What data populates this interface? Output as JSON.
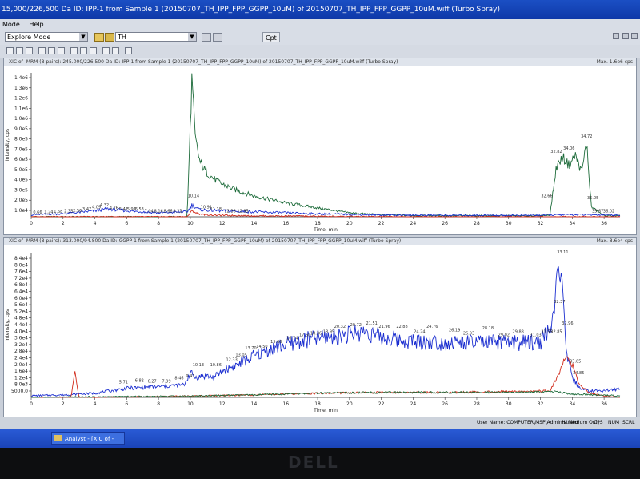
{
  "window": {
    "title": "15,000/226,500 Da ID: IPP-1 from Sample 1 (20150707_TH_IPP_FPP_GGPP_10uM) of 20150707_TH_IPP_FPP_GGPP_10uM.wiff (Turbo Spray)"
  },
  "menu": {
    "items": [
      "Mode",
      "Help"
    ]
  },
  "toolbar": {
    "mode_value": "Explore Mode",
    "history_value": "TH",
    "button_label": "Cpt"
  },
  "pane1": {
    "header": "XIC of -MRM (8 pairs): 245.000/226.500 Da ID: IPP-1 from Sample 1 (20150707_TH_IPP_FPP_GGPP_10uM) of 20150707_TH_IPP_FPP_GGPP_10uM.wiff (Turbo Spray)",
    "max_label": "Max. 1.6e6 cps",
    "xlabel": "Time, min",
    "ylabel": "Intensity, cps"
  },
  "pane2": {
    "header": "XIC of -MRM (8 pairs): 313.000/94.800 Da ID: GGPP-1 from Sample 1 (20150707_TH_IPP_FPP_GGPP_10uM) of 20150707_TH_IPP_FPP_GGPP_10uM.wiff (Turbo Spray)",
    "max_label": "Max. 8.6e4 cps",
    "xlabel": "Time, min",
    "ylabel": "Intensity, cps"
  },
  "status": {
    "user": "User Name: COMPUTER\\MSP\\Administrator",
    "mode": "HI Medium Only",
    "cps": "CPS",
    "num": "NUM",
    "scroll": "SCRL"
  },
  "taskbar": {
    "app_label": "Analyst - [XIC of -MR..."
  },
  "monitor": {
    "brand": "DELL"
  },
  "colors": {
    "blue_trace": "#1c2fd0",
    "green_trace": "#1d6b3a",
    "red_trace": "#d12a1a",
    "titlebar": "#1b4fc4"
  },
  "chart_data": [
    {
      "type": "line",
      "xlim": [
        0,
        37
      ],
      "ylim": [
        0,
        1450000.0
      ],
      "x_ticks": [
        "0",
        "2",
        "4",
        "6",
        "8",
        "10",
        "12",
        "14",
        "16",
        "18",
        "20",
        "22",
        "24",
        "26",
        "28",
        "30",
        "32",
        "34",
        "36"
      ],
      "y_ticks": [
        "1.0e4",
        "2.0e5",
        "3.0e5",
        "4.0e5",
        "5.0e5",
        "6.0e5",
        "7.0e5",
        "8.0e5",
        "9.0e5",
        "1.0e6",
        "1.1e6",
        "1.2e6",
        "1.3e6",
        "1.4e6"
      ],
      "series": [
        {
          "color": "green",
          "x": [
            0,
            9.8,
            10.1,
            10.3,
            10.6,
            11,
            11.5,
            12,
            13,
            14,
            16,
            18,
            20,
            22,
            24,
            32,
            32.6,
            33,
            33.4,
            33.8,
            34.2,
            34.6,
            34.9,
            35.2,
            36
          ],
          "y": [
            0,
            0,
            1400000.0,
            800000.0,
            550000.0,
            450000.0,
            380000.0,
            330000.0,
            260000.0,
            210000.0,
            140000.0,
            90000.0,
            40000.0,
            20000.0,
            12000.0,
            10000.0,
            20000.0,
            500000.0,
            600000.0,
            520000.0,
            620000.0,
            450000.0,
            750000.0,
            100000.0,
            10000.0
          ]
        },
        {
          "color": "blue",
          "x": [
            0,
            2,
            4,
            4.8,
            6,
            8,
            9.8,
            10.1,
            10.6,
            12,
            14,
            18,
            22,
            26,
            30,
            32,
            33,
            34,
            35,
            36
          ],
          "y": [
            20000.0,
            30000.0,
            60000.0,
            80000.0,
            60000.0,
            40000.0,
            50000.0,
            120000.0,
            70000.0,
            60000.0,
            50000.0,
            30000.0,
            18000.0,
            15000.0,
            15000.0,
            15000.0,
            20000.0,
            22000.0,
            20000.0,
            20000.0
          ]
        },
        {
          "color": "red",
          "x": [
            0,
            9.8,
            10.1,
            10.5,
            11,
            12,
            14,
            16,
            18,
            20,
            22,
            24,
            36
          ],
          "y": [
            0,
            0,
            60000.0,
            30000.0,
            20000.0,
            15000.0,
            10000.0,
            8000.0,
            5000.0,
            3000.0,
            1000.0,
            0,
            0
          ]
        }
      ],
      "peak_labels": [
        {
          "t": "0.66",
          "x": 0.4,
          "y": 15000.0
        },
        {
          "t": "1.24",
          "x": 1.1,
          "y": 20000.0
        },
        {
          "t": "1.68",
          "x": 1.7,
          "y": 25000.0
        },
        {
          "t": "2.35",
          "x": 2.35,
          "y": 30000.0
        },
        {
          "t": "2.56",
          "x": 2.9,
          "y": 32000.0
        },
        {
          "t": "3.47",
          "x": 3.5,
          "y": 50000.0
        },
        {
          "t": "4.09",
          "x": 4.1,
          "y": 70000.0
        },
        {
          "t": "4.32",
          "x": 4.6,
          "y": 90000.0
        },
        {
          "t": "4.76",
          "x": 5.2,
          "y": 60000.0
        },
        {
          "t": "5.41",
          "x": 5.8,
          "y": 50000.0
        },
        {
          "t": "5.97",
          "x": 6.3,
          "y": 50000.0
        },
        {
          "t": "6.53",
          "x": 6.8,
          "y": 50000.0
        },
        {
          "t": "7.04",
          "x": 7.4,
          "y": 30000.0
        },
        {
          "t": "8.16",
          "x": 8.0,
          "y": 30000.0
        },
        {
          "t": "8.66",
          "x": 8.6,
          "y": 30000.0
        },
        {
          "t": "9.23",
          "x": 9.2,
          "y": 30000.0
        },
        {
          "t": "10.14",
          "x": 10.2,
          "y": 180000.0
        },
        {
          "t": "10.91",
          "x": 11.0,
          "y": 70000.0
        },
        {
          "t": "11.18",
          "x": 11.6,
          "y": 50000.0
        },
        {
          "t": "12.38",
          "x": 12.5,
          "y": 30000.0
        },
        {
          "t": "12.95",
          "x": 13.3,
          "y": 30000.0
        },
        {
          "t": "32.66",
          "x": 32.4,
          "y": 180000.0
        },
        {
          "t": "32.82",
          "x": 33.0,
          "y": 630000.0
        },
        {
          "t": "34.06",
          "x": 33.8,
          "y": 660000.0
        },
        {
          "t": "34.72",
          "x": 34.9,
          "y": 780000.0
        },
        {
          "t": "35.05",
          "x": 35.3,
          "y": 160000.0
        },
        {
          "t": "35.67",
          "x": 35.6,
          "y": 30000.0
        },
        {
          "t": "36.02",
          "x": 36.3,
          "y": 30000.0
        }
      ]
    },
    {
      "type": "line",
      "xlim": [
        0,
        37
      ],
      "ylim": [
        0,
        87000.0
      ],
      "x_ticks": [
        "0",
        "2",
        "4",
        "6",
        "8",
        "10",
        "12",
        "14",
        "16",
        "18",
        "20",
        "22",
        "24",
        "26",
        "28",
        "30",
        "32",
        "34",
        "36"
      ],
      "y_ticks": [
        "5000.0",
        "8.0e3",
        "1.2e4",
        "1.6e4",
        "2.0e4",
        "2.4e4",
        "2.8e4",
        "3.2e4",
        "3.6e4",
        "4.0e4",
        "4.4e4",
        "4.8e4",
        "5.2e4",
        "5.6e4",
        "6.0e4",
        "6.4e4",
        "6.8e4",
        "7.2e4",
        "7.6e4",
        "8.0e4",
        "8.4e4"
      ],
      "series": [
        {
          "color": "blue",
          "x": [
            0,
            2,
            4,
            6,
            8,
            9.6,
            10,
            10.3,
            11,
            11.5,
            12,
            13,
            14,
            15,
            16,
            17,
            18,
            19,
            20,
            21,
            22,
            23,
            24,
            25,
            26,
            27,
            28,
            29,
            30,
            31,
            32,
            32.8,
            33.2,
            33.6,
            34,
            34.6,
            35,
            36,
            37
          ],
          "y": [
            1000.0,
            1500.0,
            2500.0,
            5500.0,
            6500.0,
            7500.0,
            15000.0,
            12000.0,
            13000.0,
            12000.0,
            16000.0,
            20000.0,
            25000.0,
            29000.0,
            32000.0,
            34000.0,
            36000.0,
            37000.0,
            38000.0,
            40000.0,
            36000.0,
            35000.0,
            34000.0,
            33500.0,
            33000.0,
            33000.0,
            33000.0,
            33000.0,
            33000.0,
            33000.0,
            33500.0,
            45000.0,
            85000.0,
            30000.0,
            11000.0,
            5000.0,
            4000.0,
            4000.0,
            5000.0
          ]
        },
        {
          "color": "red",
          "x": [
            0,
            2.5,
            2.75,
            3.0,
            3.5,
            8,
            10,
            14,
            18,
            22,
            26,
            30,
            32.6,
            33.2,
            33.6,
            34,
            34.4,
            35,
            36,
            37
          ],
          "y": [
            0,
            0,
            15000.0,
            0,
            0,
            500,
            800,
            1500.0,
            2500.0,
            3000.0,
            3000.0,
            3500.0,
            4000.0,
            15000.0,
            25000.0,
            20000.0,
            8000.0,
            3000.0,
            1000.0,
            0
          ]
        },
        {
          "color": "green",
          "x": [
            0,
            10,
            14,
            18,
            22,
            26,
            30,
            33,
            34,
            37
          ],
          "y": [
            0,
            800,
            1500.0,
            2500.0,
            3000.0,
            3000.0,
            3000.0,
            3500.0,
            2000.0,
            1000.0
          ]
        }
      ],
      "peak_labels": [
        {
          "t": "5.71",
          "x": 5.8,
          "y": 7500.0
        },
        {
          "t": "6.82",
          "x": 6.8,
          "y": 8500.0
        },
        {
          "t": "6.27",
          "x": 7.6,
          "y": 8000.0
        },
        {
          "t": "7.99",
          "x": 8.5,
          "y": 8000.0
        },
        {
          "t": "8.46",
          "x": 9.3,
          "y": 10000.0
        },
        {
          "t": "9.47",
          "x": 10.0,
          "y": 11000.0
        },
        {
          "t": "10.13",
          "x": 10.5,
          "y": 18000.0
        },
        {
          "t": "10.86",
          "x": 11.6,
          "y": 18000.0
        },
        {
          "t": "12.33",
          "x": 12.6,
          "y": 21000.0
        },
        {
          "t": "13.05",
          "x": 13.2,
          "y": 24000.0
        },
        {
          "t": "13.70",
          "x": 13.8,
          "y": 28000.0
        },
        {
          "t": "14.50",
          "x": 14.5,
          "y": 29000.0
        },
        {
          "t": "15.66",
          "x": 15.4,
          "y": 32000.0
        },
        {
          "t": "16.74",
          "x": 16.4,
          "y": 34000.0
        },
        {
          "t": "17.60",
          "x": 17.2,
          "y": 36000.0
        },
        {
          "t": "18.36",
          "x": 17.9,
          "y": 37000.0
        },
        {
          "t": "18.95",
          "x": 18.7,
          "y": 38000.0
        },
        {
          "t": "20.32",
          "x": 19.4,
          "y": 41000.0
        },
        {
          "t": "20.72",
          "x": 20.4,
          "y": 42000.0
        },
        {
          "t": "21.51",
          "x": 21.4,
          "y": 43000.0
        },
        {
          "t": "21.96",
          "x": 22.2,
          "y": 41000.0
        },
        {
          "t": "22.88",
          "x": 23.3,
          "y": 41000.0
        },
        {
          "t": "24.24",
          "x": 24.4,
          "y": 38000.0
        },
        {
          "t": "24.76",
          "x": 25.2,
          "y": 41000.0
        },
        {
          "t": "26.19",
          "x": 26.6,
          "y": 39000.0
        },
        {
          "t": "26.93",
          "x": 27.5,
          "y": 37000.0
        },
        {
          "t": "28.18",
          "x": 28.7,
          "y": 40000.0
        },
        {
          "t": "29.02",
          "x": 29.7,
          "y": 36000.0
        },
        {
          "t": "29.88",
          "x": 30.6,
          "y": 38000.0
        },
        {
          "t": "31.03",
          "x": 31.7,
          "y": 36000.0
        },
        {
          "t": "31.55",
          "x": 32.4,
          "y": 38000.0
        },
        {
          "t": "32.85",
          "x": 33.0,
          "y": 38000.0
        },
        {
          "t": "32.37",
          "x": 33.2,
          "y": 56000.0
        },
        {
          "t": "32.96",
          "x": 33.7,
          "y": 43000.0
        },
        {
          "t": "33.11",
          "x": 33.4,
          "y": 86000.0
        },
        {
          "t": "33.85",
          "x": 34.2,
          "y": 20000.0
        },
        {
          "t": "34.85",
          "x": 34.4,
          "y": 13000.0
        }
      ]
    }
  ]
}
